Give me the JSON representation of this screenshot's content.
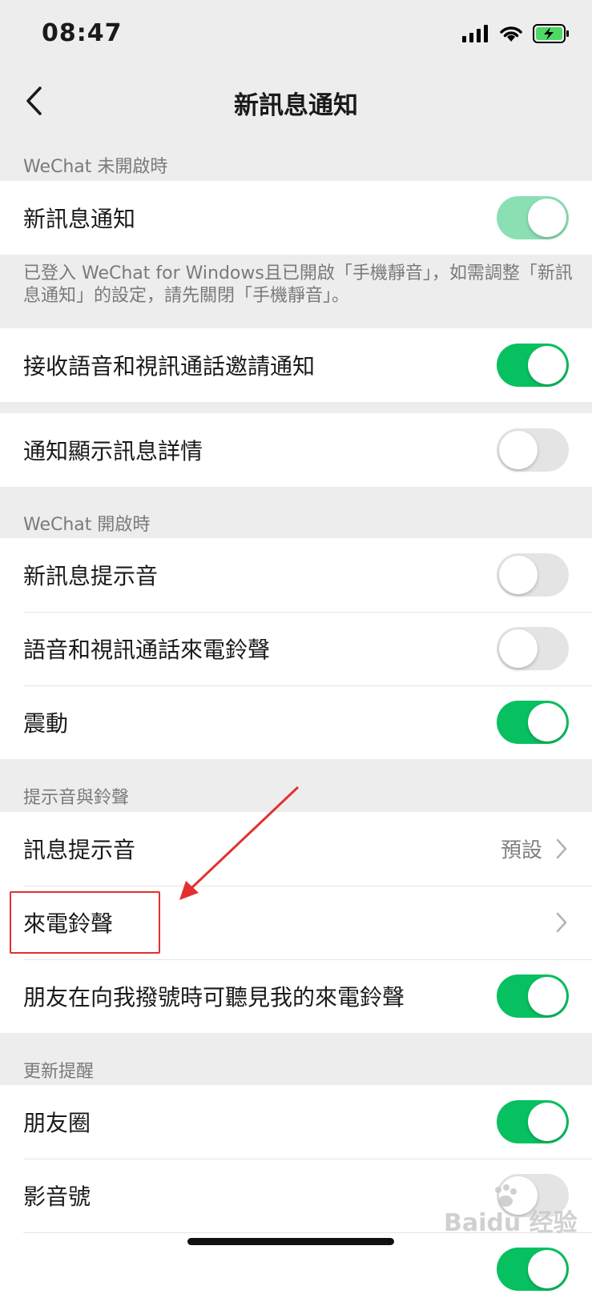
{
  "status_bar": {
    "time": "08:47"
  },
  "nav": {
    "title": "新訊息通知"
  },
  "sections": {
    "closed_header": "WeChat 未開啟時",
    "closed_note": "已登入 WeChat for Windows且已開啟「手機靜音」，如需調整「新訊息通知」的設定，請先關閉「手機靜音」。",
    "open_header": "WeChat 開啟時",
    "sound_header": "提示音與鈴聲",
    "update_header": "更新提醒"
  },
  "rows": {
    "new_message": {
      "label": "新訊息通知",
      "on": true
    },
    "call_invite": {
      "label": "接收語音和視訊通話邀請通知",
      "on": true
    },
    "show_details": {
      "label": "通知顯示訊息詳情",
      "on": false
    },
    "message_tone": {
      "label": "新訊息提示音",
      "on": false
    },
    "call_ringtone": {
      "label": "語音和視訊通話來電鈴聲",
      "on": false
    },
    "vibrate": {
      "label": "震動",
      "on": true
    },
    "alert_sound": {
      "label": "訊息提示音",
      "value": "預設"
    },
    "ringtone": {
      "label": "來電鈴聲"
    },
    "friends_hear": {
      "label": "朋友在向我撥號時可聽見我的來電鈴聲",
      "on": true
    },
    "moments": {
      "label": "朋友圈",
      "on": true
    },
    "channels": {
      "label": "影音號",
      "on": false
    }
  },
  "watermark": {
    "text": "Baidu 经验"
  },
  "colors": {
    "accent": "#07c160",
    "highlight": "#e23030"
  }
}
